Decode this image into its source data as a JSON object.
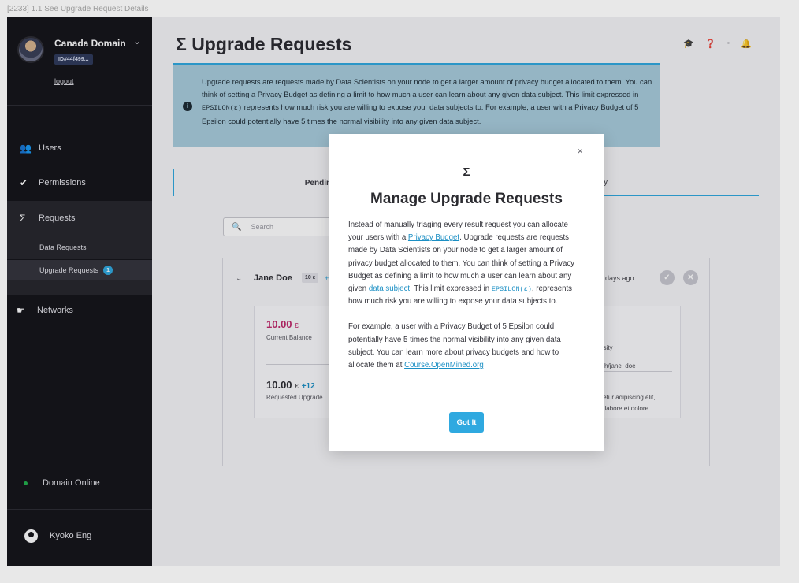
{
  "frame": {
    "label": "[2233] 1.1 See Upgrade Request Details"
  },
  "sidebar": {
    "domain_name": "Canada Domain",
    "domain_id": "ID#44f499...",
    "logout": "logout",
    "nav": [
      {
        "icon": "users-icon",
        "label": "Users"
      },
      {
        "icon": "check-icon",
        "label": "Permissions"
      },
      {
        "icon": "sigma-icon",
        "label": "Requests"
      },
      {
        "icon": "networks-icon",
        "label": "Networks"
      }
    ],
    "sub_items": [
      {
        "label": "Data Requests"
      },
      {
        "label": "Upgrade Requests",
        "badge": "1"
      }
    ],
    "status": "Domain Online",
    "user_name": "Kyoko Eng"
  },
  "header": {
    "title": "Σ Upgrade Requests",
    "icons": [
      "graduation-cap-icon",
      "help-icon",
      "dot",
      "bell-icon"
    ]
  },
  "info": {
    "text_before": "Upgrade requests are requests made by Data Scientists on your node to get a larger amount of privacy budget allocated to them. You can think of setting a Privacy Budget as defining a limit to how much a user can learn about any given data subject. This limit expressed in ",
    "mono": "EPSILON(ε)",
    "text_after": " represents how much risk you are willing to expose your data subjects to. For example, a user with a Privacy Budget of 5 Epsilon could potentially have 5 times the normal visibility into any given data subject."
  },
  "tabs": {
    "pending": "Pending",
    "history": "History"
  },
  "search": {
    "placeholder": "Search"
  },
  "card": {
    "name": "Jane Doe",
    "eps": "10 ε",
    "plus": "+",
    "time": "days ago",
    "current_balance": "10.00",
    "current_balance_unit": "ε",
    "current_balance_label": "Current Balance",
    "requested": "10.00",
    "requested_unit": "ε",
    "requested_plus": "+12",
    "requested_label": "Requested Upgrade",
    "side_university": "rsity",
    "side_link": "ch/jane_doe",
    "side_text_1": "tetur adipiscing elit,",
    "side_text_2": "t labore et dolore"
  },
  "modal": {
    "sigma": "Σ",
    "title": "Manage Upgrade Requests",
    "p1_a": "Instead of manually triaging every result request you can allocate your users with a ",
    "p1_link1": "Privacy Budget",
    "p1_b": ". Upgrade requests are requests made by Data Scientists on your node to get a larger amount of privacy budget allocated to them. You can think of setting a Privacy Budget as defining a limit to how much a user can learn about any given ",
    "p1_link2": "data subject",
    "p1_c": ". This limit expressed in ",
    "p1_mono": "EPSILON(ε)",
    "p1_d": ", represents how much risk you are willing to expose your data subjects to.",
    "p2_a": "For example, a user with a Privacy Budget of 5 Epsilon could potentially have 5 times the normal visibility into any given data subject. You can learn more about privacy budgets and how to allocate them at ",
    "p2_link": "Course.OpenMined.org",
    "button": "Got It",
    "close": "×"
  },
  "colors": {
    "accent": "#2fa9e0",
    "sidebar_bg": "#141418",
    "info_bg": "#a8ccdc",
    "balance": "#c0276a",
    "requested_plus": "#1b8fc4",
    "online": "#22b14c"
  }
}
